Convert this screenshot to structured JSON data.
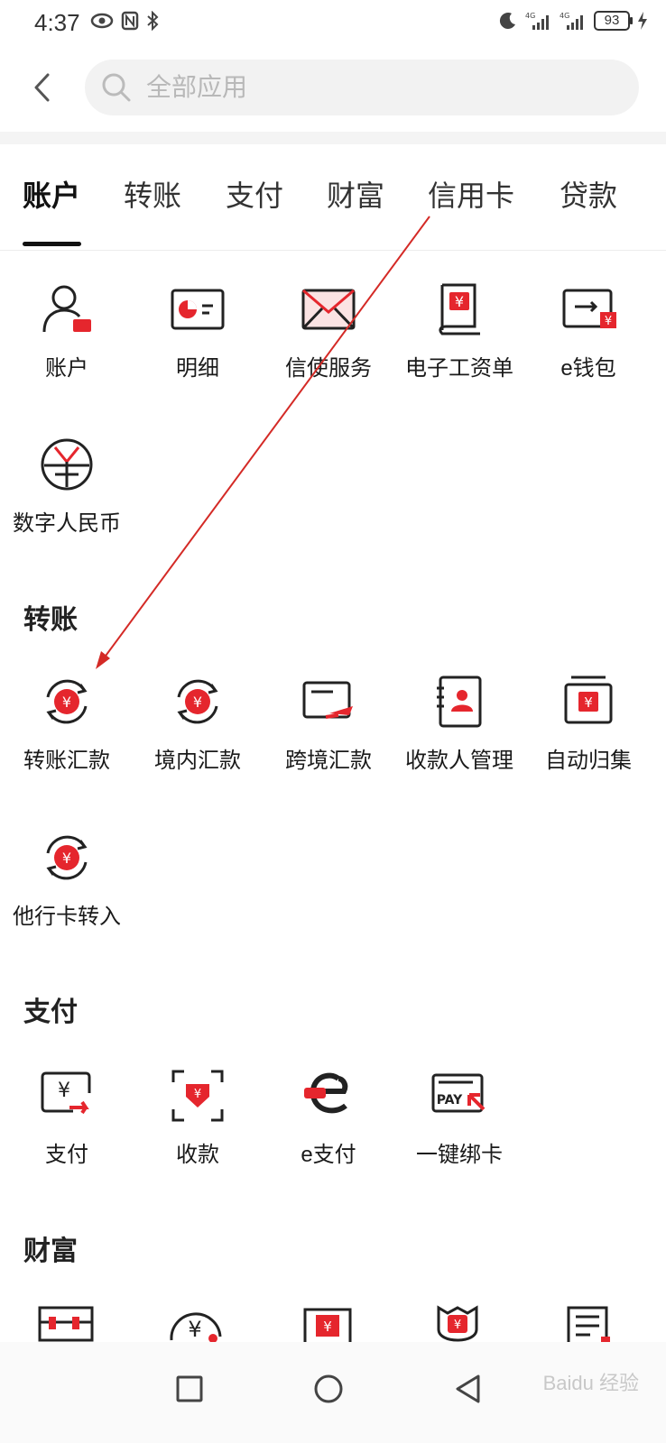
{
  "status_bar": {
    "time": "4:37",
    "battery": "93"
  },
  "search": {
    "placeholder": "全部应用"
  },
  "tabs": [
    {
      "label": "账户"
    },
    {
      "label": "转账"
    },
    {
      "label": "支付"
    },
    {
      "label": "财富"
    },
    {
      "label": "信用卡"
    },
    {
      "label": "贷款"
    }
  ],
  "account_items": [
    {
      "label": "账户",
      "icon": "user-icon"
    },
    {
      "label": "明细",
      "icon": "pie-chart-card-icon"
    },
    {
      "label": "信使服务",
      "icon": "envelope-icon"
    },
    {
      "label": "电子工资单",
      "icon": "payslip-icon"
    },
    {
      "label": "e钱包",
      "icon": "wallet-icon"
    },
    {
      "label": "数字人民币",
      "icon": "digital-rmb-icon"
    }
  ],
  "sections": {
    "transfer": "转账",
    "payment": "支付",
    "wealth": "财富"
  },
  "transfer_items": [
    {
      "label": "转账汇款",
      "icon": "yuan-cycle-icon"
    },
    {
      "label": "境内汇款",
      "icon": "yuan-cycle-icon"
    },
    {
      "label": "跨境汇款",
      "icon": "cross-border-icon"
    },
    {
      "label": "收款人管理",
      "icon": "payee-book-icon"
    },
    {
      "label": "自动归集",
      "icon": "auto-collect-icon"
    },
    {
      "label": "他行卡转入",
      "icon": "yuan-cycle-icon"
    }
  ],
  "payment_items": [
    {
      "label": "支付",
      "icon": "pay-icon"
    },
    {
      "label": "收款",
      "icon": "receive-icon"
    },
    {
      "label": "e支付",
      "icon": "e-pay-icon"
    },
    {
      "label": "一键绑卡",
      "icon": "pay-card-icon"
    }
  ],
  "watermark": "Baidu 经验",
  "colors": {
    "accent": "#e5262d",
    "text": "#1a1a1a",
    "annotation": "#d42a26"
  }
}
